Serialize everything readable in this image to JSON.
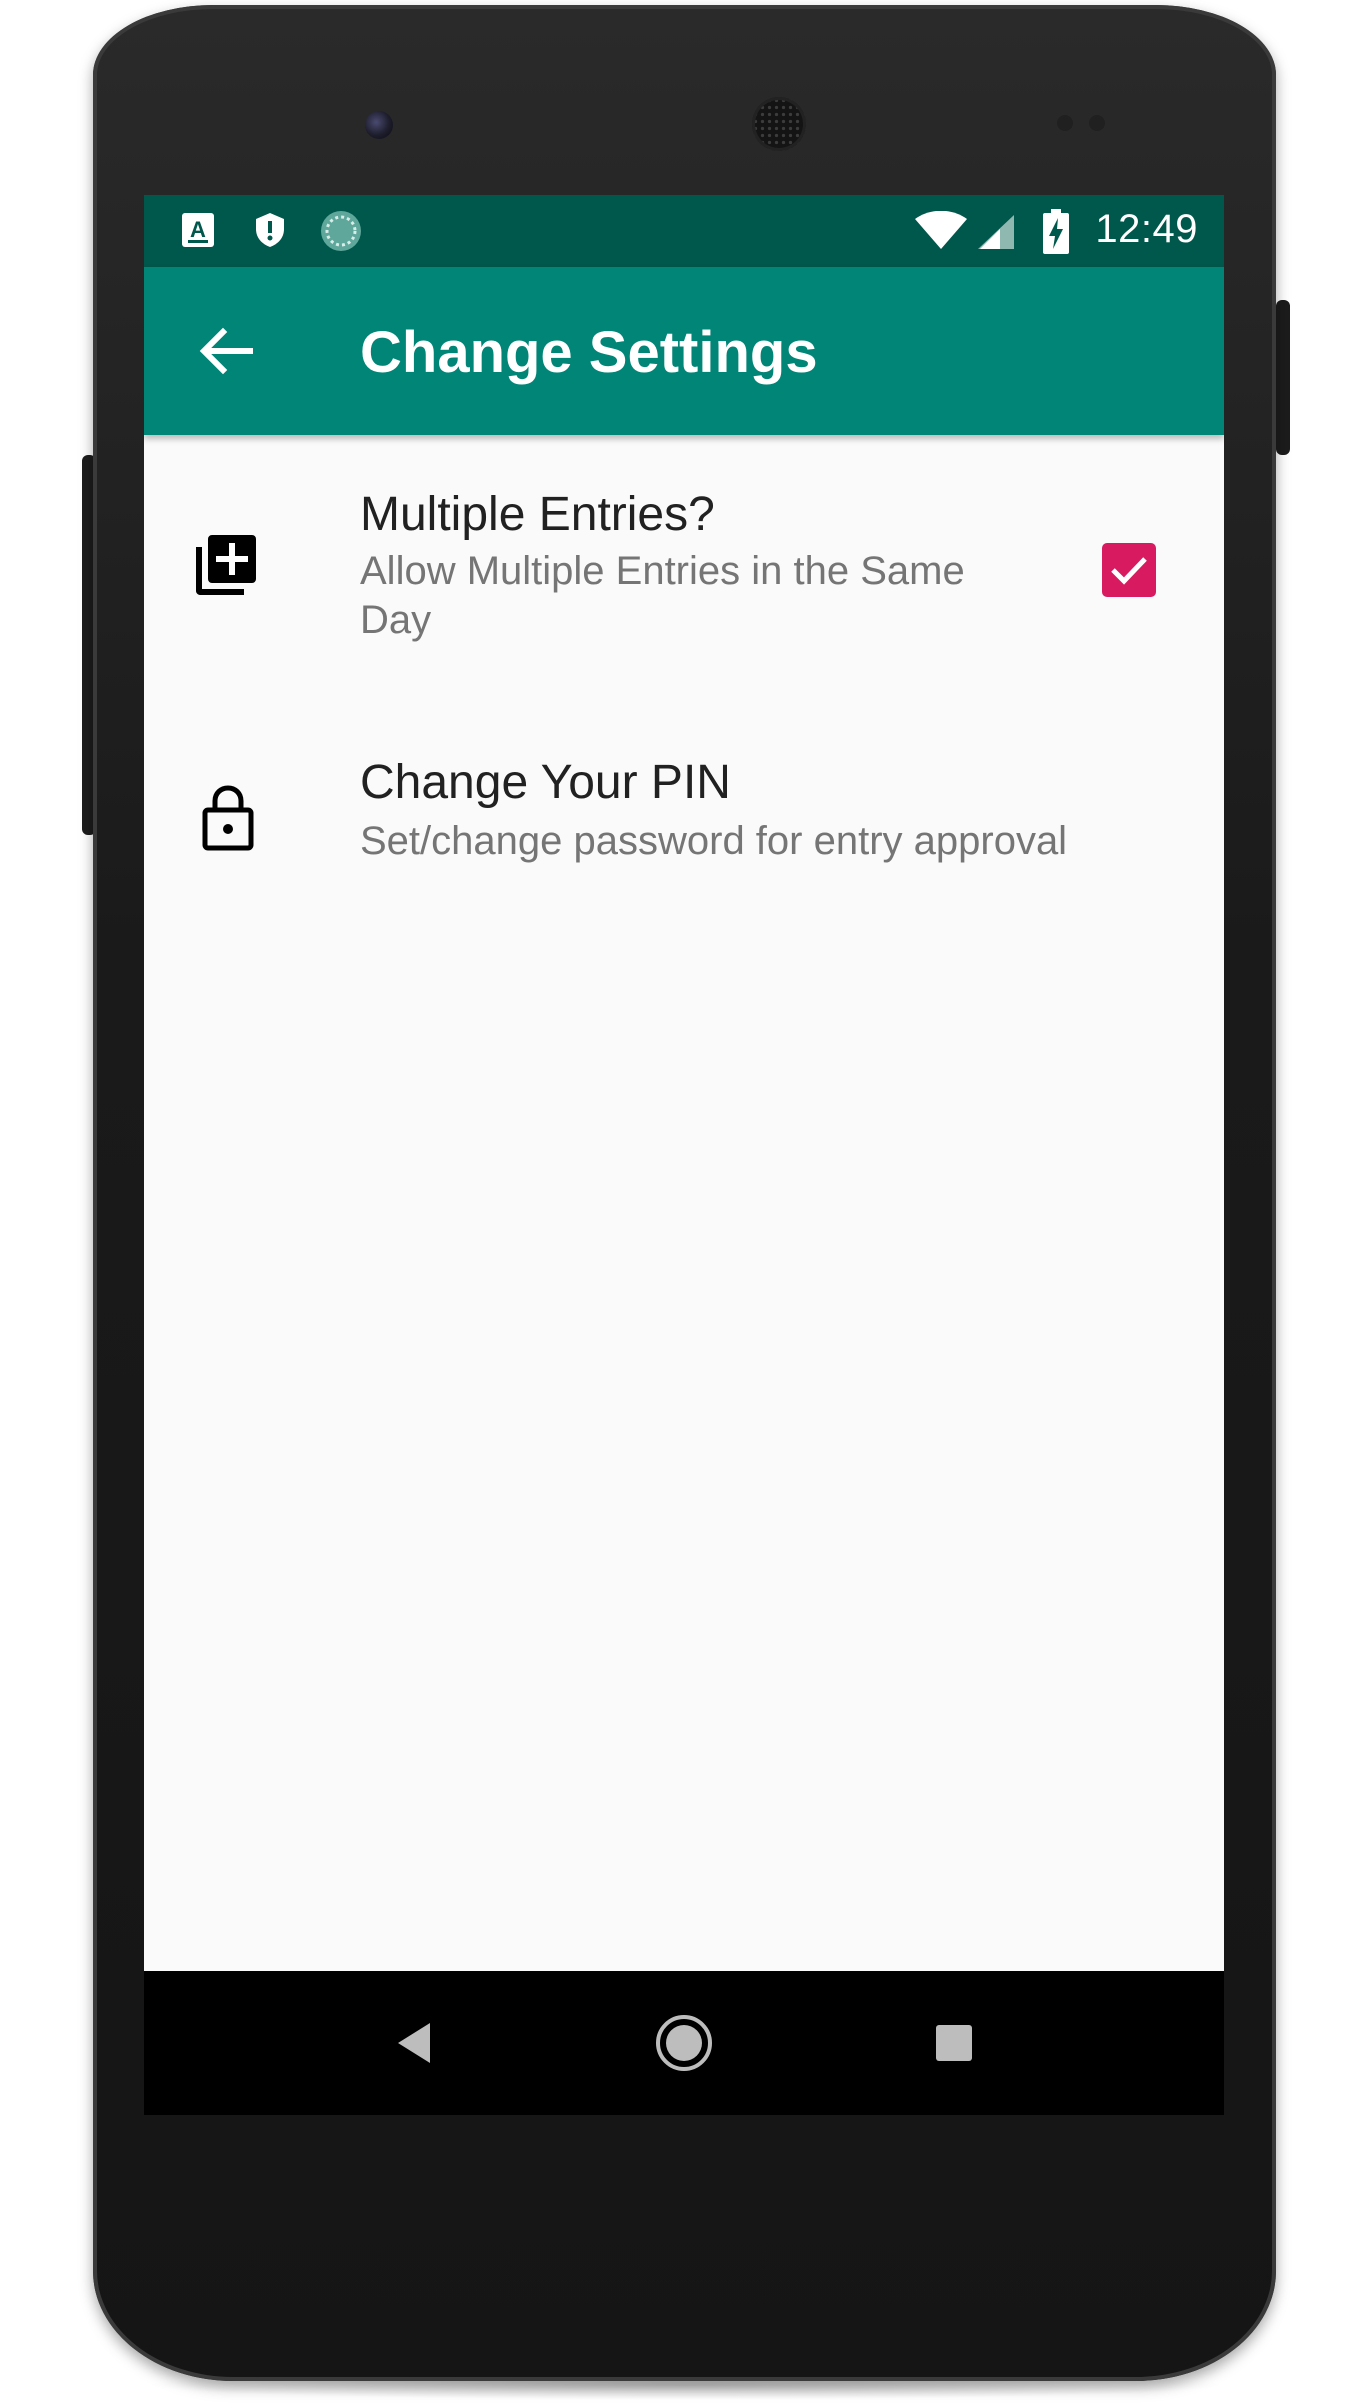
{
  "status_bar": {
    "time": "12:49",
    "icons": [
      "accessibility-a-icon",
      "shield-icon",
      "progress-circle-icon",
      "wifi-icon",
      "cell-signal-icon",
      "battery-charging-icon"
    ]
  },
  "app_bar": {
    "title": "Change Settings",
    "back_icon": "arrow-back-icon"
  },
  "preferences": [
    {
      "icon": "library-add-icon",
      "title": "Multiple Entries?",
      "summary": "Allow Multiple Entries in the Same Day",
      "checked": true
    },
    {
      "icon": "lock-icon",
      "title": "Change Your PIN",
      "summary": "Set/change password for entry approval"
    }
  ],
  "nav_bar": {
    "icons": [
      "back-triangle-icon",
      "home-circle-icon",
      "recents-square-icon"
    ]
  },
  "colors": {
    "status_bar": "#00574b",
    "app_bar": "#008577",
    "accent": "#d81b60",
    "background": "#fafafa"
  }
}
